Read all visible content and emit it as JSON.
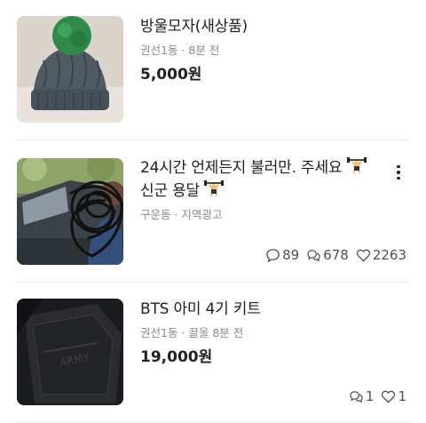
{
  "listings": [
    {
      "title": "방울모자(새상품)",
      "meta": "권선1동 · 8분 전",
      "price": "5,000원",
      "image_icon": "knit-beanie-photo"
    },
    {
      "title_line1": "24시간 언제든지 불러만. 주세요",
      "title_line2": "신군 용달",
      "meta": "구운동 · 지역광고",
      "image_icon": "person-with-car-photo",
      "stats": {
        "chats": "89",
        "comments": "678",
        "likes": "2263"
      }
    },
    {
      "title": "BTS 아미 4기 키트",
      "meta": "권선1동 · 끌올 8분 전",
      "price": "19,000원",
      "image_icon": "black-box-photo",
      "stats": {
        "chats": "1",
        "likes": "1"
      }
    }
  ],
  "colors": {
    "text": "#212124",
    "meta": "#868b94",
    "divider": "#eaebee",
    "accent": "#ff7e36"
  }
}
